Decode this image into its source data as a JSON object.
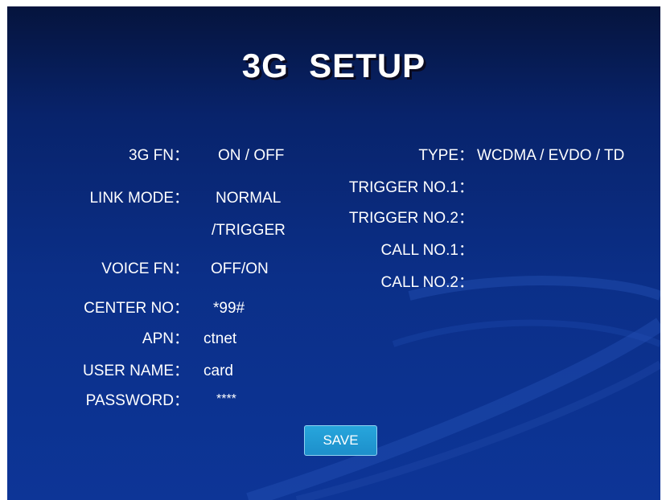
{
  "title": "3G  SETUP",
  "left": {
    "fn_label": "3G FN：",
    "fn_value": "ON / OFF",
    "link_mode_label": "LINK MODE：",
    "link_mode_value_1": "NORMAL",
    "link_mode_value_2": "/TRIGGER",
    "voice_fn_label": "VOICE FN：",
    "voice_fn_value": "OFF/ON",
    "center_no_label": "CENTER NO：",
    "center_no_value": "*99#",
    "apn_label": "APN：",
    "apn_value": "ctnet",
    "user_name_label": "USER NAME：",
    "user_name_value": "card",
    "password_label": "PASSWORD：",
    "password_value": "****"
  },
  "right": {
    "type_label": "TYPE：",
    "type_value": "WCDMA / EVDO / TD",
    "trigger_no1_label": "TRIGGER NO.1：",
    "trigger_no2_label": "TRIGGER NO.2：",
    "call_no1_label": "CALL NO.1：",
    "call_no2_label": "CALL NO.2："
  },
  "save_label": "SAVE",
  "colors": {
    "background_top": "#05143d",
    "background_bottom": "#0d3597",
    "text": "#ffffff",
    "button": "#1d8fcb",
    "button_border": "#8fd3f2"
  }
}
